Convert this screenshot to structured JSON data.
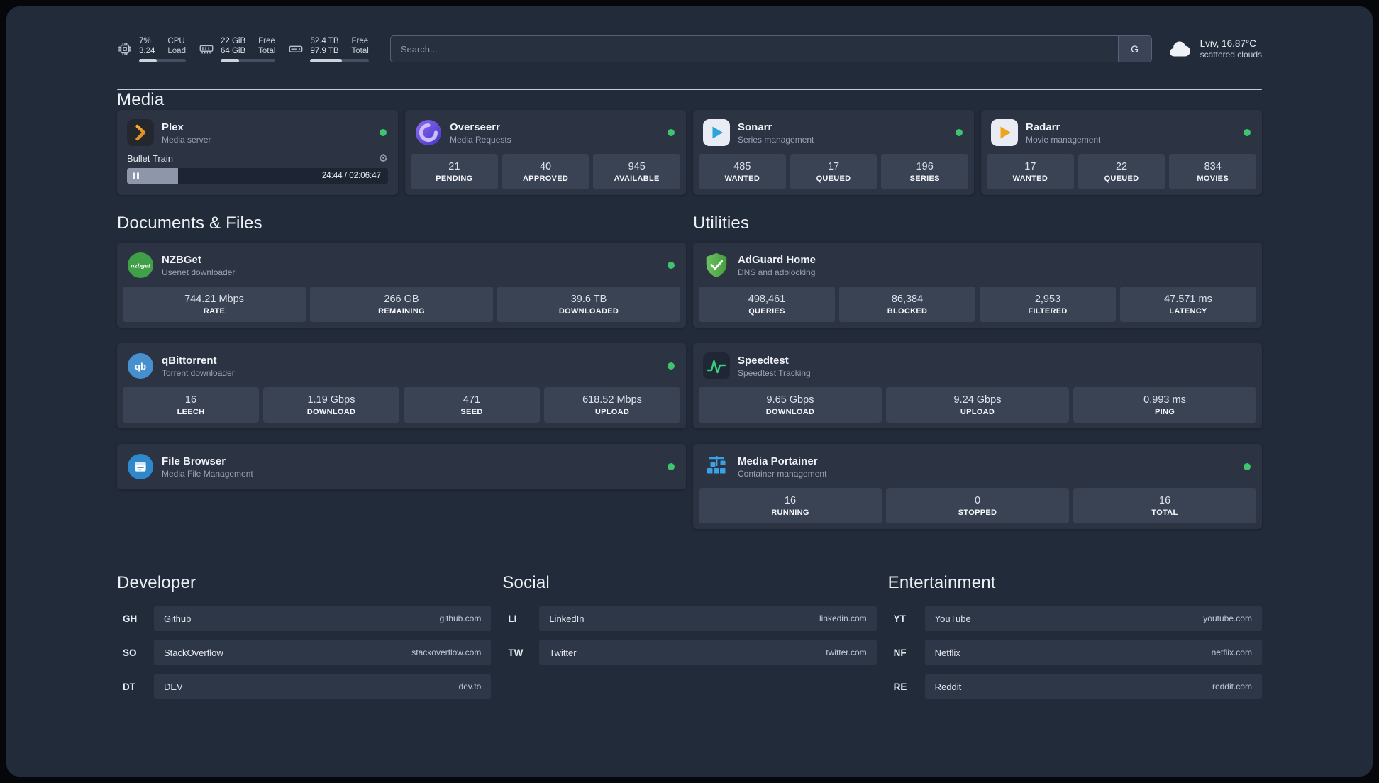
{
  "topbar": {
    "cpu": {
      "value_top": "7%",
      "value_bottom": "3.24",
      "label_top": "CPU",
      "label_bottom": "Load",
      "bar_percent": 38
    },
    "ram": {
      "value_top": "22 GiB",
      "value_bottom": "64 GiB",
      "label_top": "Free",
      "label_bottom": "Total",
      "bar_percent": 34
    },
    "disk": {
      "value_top": "52.4 TB",
      "value_bottom": "97.9 TB",
      "label_top": "Free",
      "label_bottom": "Total",
      "bar_percent": 54
    },
    "search": {
      "placeholder": "Search...",
      "button_label": "G"
    },
    "weather": {
      "location": "Lviv, 16.87°C",
      "condition": "scattered clouds"
    }
  },
  "icons": {
    "gear": "⚙"
  },
  "media": {
    "heading": "Media",
    "apps": [
      {
        "name": "Plex",
        "subtitle": "Media server",
        "icon": "plex-icon",
        "online": true,
        "player": {
          "track": "Bullet Train",
          "time": "24:44 / 02:06:47",
          "progress_percent": 19.5
        }
      },
      {
        "name": "Overseerr",
        "subtitle": "Media Requests",
        "icon": "overseerr-icon",
        "online": true,
        "stats": [
          {
            "value": "21",
            "label": "PENDING"
          },
          {
            "value": "40",
            "label": "APPROVED"
          },
          {
            "value": "945",
            "label": "AVAILABLE"
          }
        ]
      },
      {
        "name": "Sonarr",
        "subtitle": "Series management",
        "icon": "sonarr-icon",
        "online": true,
        "stats": [
          {
            "value": "485",
            "label": "WANTED"
          },
          {
            "value": "17",
            "label": "QUEUED"
          },
          {
            "value": "196",
            "label": "SERIES"
          }
        ]
      },
      {
        "name": "Radarr",
        "subtitle": "Movie management",
        "icon": "radarr-icon",
        "online": true,
        "stats": [
          {
            "value": "17",
            "label": "WANTED"
          },
          {
            "value": "22",
            "label": "QUEUED"
          },
          {
            "value": "834",
            "label": "MOVIES"
          }
        ]
      }
    ]
  },
  "documents": {
    "heading": "Documents & Files",
    "apps": [
      {
        "name": "NZBGet",
        "subtitle": "Usenet downloader",
        "icon": "nzbget-icon",
        "online": true,
        "stats": [
          {
            "value": "744.21 Mbps",
            "label": "RATE"
          },
          {
            "value": "266 GB",
            "label": "REMAINING"
          },
          {
            "value": "39.6 TB",
            "label": "DOWNLOADED"
          }
        ]
      },
      {
        "name": "qBittorrent",
        "subtitle": "Torrent downloader",
        "icon": "qbittorrent-icon",
        "online": true,
        "stats": [
          {
            "value": "16",
            "label": "LEECH"
          },
          {
            "value": "1.19 Gbps",
            "label": "DOWNLOAD"
          },
          {
            "value": "471",
            "label": "SEED"
          },
          {
            "value": "618.52 Mbps",
            "label": "UPLOAD"
          }
        ]
      },
      {
        "name": "File Browser",
        "subtitle": "Media File Management",
        "icon": "filebrowser-icon",
        "online": true
      }
    ]
  },
  "utilities": {
    "heading": "Utilities",
    "apps": [
      {
        "name": "AdGuard Home",
        "subtitle": "DNS and adblocking",
        "icon": "adguard-icon",
        "online": false,
        "stats": [
          {
            "value": "498,461",
            "label": "QUERIES"
          },
          {
            "value": "86,384",
            "label": "BLOCKED"
          },
          {
            "value": "2,953",
            "label": "FILTERED"
          },
          {
            "value": "47.571 ms",
            "label": "LATENCY"
          }
        ]
      },
      {
        "name": "Speedtest",
        "subtitle": "Speedtest Tracking",
        "icon": "speedtest-icon",
        "online": false,
        "stats": [
          {
            "value": "9.65 Gbps",
            "label": "DOWNLOAD"
          },
          {
            "value": "9.24 Gbps",
            "label": "UPLOAD"
          },
          {
            "value": "0.993 ms",
            "label": "PING"
          }
        ]
      },
      {
        "name": "Media Portainer",
        "subtitle": "Container management",
        "icon": "portainer-icon",
        "online": true,
        "stats": [
          {
            "value": "16",
            "label": "RUNNING"
          },
          {
            "value": "0",
            "label": "STOPPED"
          },
          {
            "value": "16",
            "label": "TOTAL"
          }
        ]
      }
    ]
  },
  "bookmarks": {
    "groups": [
      {
        "heading": "Developer",
        "items": [
          {
            "abbr": "GH",
            "name": "Github",
            "url": "github.com"
          },
          {
            "abbr": "SO",
            "name": "StackOverflow",
            "url": "stackoverflow.com"
          },
          {
            "abbr": "DT",
            "name": "DEV",
            "url": "dev.to"
          }
        ]
      },
      {
        "heading": "Social",
        "items": [
          {
            "abbr": "LI",
            "name": "LinkedIn",
            "url": "linkedin.com"
          },
          {
            "abbr": "TW",
            "name": "Twitter",
            "url": "twitter.com"
          }
        ]
      },
      {
        "heading": "Entertainment",
        "items": [
          {
            "abbr": "YT",
            "name": "YouTube",
            "url": "youtube.com"
          },
          {
            "abbr": "NF",
            "name": "Netflix",
            "url": "netflix.com"
          },
          {
            "abbr": "RE",
            "name": "Reddit",
            "url": "reddit.com"
          }
        ]
      }
    ]
  },
  "colors": {
    "background": "#222b3a",
    "card": "#2c3444",
    "tile": "#3a4354",
    "status_online": "#3ec46d",
    "accent_green": "#35d07f"
  }
}
